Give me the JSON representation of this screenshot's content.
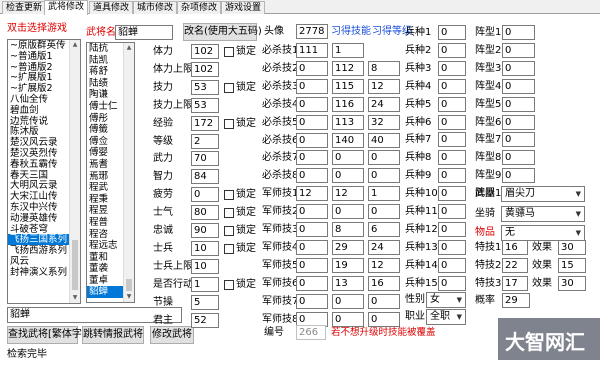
{
  "tabs": [
    {
      "label": "检查更新"
    },
    {
      "label": "武将修改"
    },
    {
      "label": "道具修改"
    },
    {
      "label": "城市修改"
    },
    {
      "label": "杂项修改"
    },
    {
      "label": "游戏设置"
    }
  ],
  "left": {
    "header": "双击选择游戏",
    "games": [
      "~原版群英传",
      "~普通版1",
      "~普通版2",
      "~扩展版1",
      "~扩展版2",
      "八仙全传",
      "碧血剑",
      "边荒传说",
      "陈沐版",
      "楚汉风云录",
      "楚汉英烈传",
      "春秋五霸传",
      "春天三国",
      "大明风云录",
      "大宋江山传",
      "东汉中兴传",
      "动漫英雄传",
      "斗破苍穹",
      "飞扬三国系列",
      "飞扬西游系列",
      "风云",
      "封神演义系列"
    ],
    "selected_game": "飞扬三国系列",
    "search_value": "貂蝉",
    "btn_search": "查找武将[繁体字]",
    "btn_jump": "跳转情报武将",
    "status": "检索完毕"
  },
  "generals": {
    "header": "武将名",
    "name_value": "貂蝉",
    "items": [
      "陆抗",
      "陆凯",
      "蒋舒",
      "陆绩",
      "陶谦",
      "傅士仁",
      "傅彤",
      "傅籤",
      "傅佥",
      "傅婴",
      "焉耆",
      "焉琊",
      "程武",
      "程秉",
      "程昱",
      "程普",
      "程咨",
      "程远志",
      "董和",
      "董袭",
      "董卓",
      "貂蝉"
    ],
    "selected": "貂蝉"
  },
  "edit": {
    "btn_rename": "改名(使用大五码)",
    "btn_modify": "修改武将",
    "lock_label": "锁定"
  },
  "stats": [
    {
      "label": "体力",
      "value": "102",
      "lock": true
    },
    {
      "label": "体力上限",
      "value": "102",
      "lock": false
    },
    {
      "label": "技力",
      "value": "53",
      "lock": true
    },
    {
      "label": "技力上限",
      "value": "53",
      "lock": false
    },
    {
      "label": "经验",
      "value": "172",
      "lock": true
    },
    {
      "label": "等级",
      "value": "2",
      "lock": false
    },
    {
      "label": "武力",
      "value": "70",
      "lock": false
    },
    {
      "label": "智力",
      "value": "84",
      "lock": false
    },
    {
      "label": "疲劳",
      "value": "0",
      "lock": true
    },
    {
      "label": "士气",
      "value": "80",
      "lock": true
    },
    {
      "label": "忠诚",
      "value": "90",
      "lock": true
    },
    {
      "label": "士兵",
      "value": "10",
      "lock": true
    },
    {
      "label": "士兵上限",
      "value": "10",
      "lock": false
    },
    {
      "label": "是否行动",
      "value": "1",
      "lock": true
    },
    {
      "label": "节操",
      "value": "5",
      "lock": false
    },
    {
      "label": "君主",
      "value": "52",
      "lock": false
    }
  ],
  "portrait": {
    "label": "头像",
    "value": "2778",
    "learned_label": "习得技能",
    "level_label": "习得等级"
  },
  "skills": [
    {
      "label": "必杀技1",
      "a": "111",
      "b": "1"
    },
    {
      "label": "必杀技2",
      "a": "0",
      "b": "112",
      "c": "8"
    },
    {
      "label": "必杀技3",
      "a": "0",
      "b": "115",
      "c": "12"
    },
    {
      "label": "必杀技4",
      "a": "0",
      "b": "116",
      "c": "24"
    },
    {
      "label": "必杀技5",
      "a": "0",
      "b": "113",
      "c": "32"
    },
    {
      "label": "必杀技6",
      "a": "0",
      "b": "140",
      "c": "40"
    },
    {
      "label": "必杀技7",
      "a": "0",
      "b": "0",
      "c": "0"
    },
    {
      "label": "必杀技8",
      "a": "0",
      "b": "0",
      "c": "0"
    },
    {
      "label": "军师技1",
      "a": "12",
      "b": "12",
      "c": "1"
    },
    {
      "label": "军师技2",
      "a": "0",
      "b": "0",
      "c": "0"
    },
    {
      "label": "军师技3",
      "a": "0",
      "b": "8",
      "c": "6"
    },
    {
      "label": "军师技4",
      "a": "0",
      "b": "29",
      "c": "24"
    },
    {
      "label": "军师技5",
      "a": "0",
      "b": "19",
      "c": "12"
    },
    {
      "label": "军师技6",
      "a": "0",
      "b": "13",
      "c": "16"
    },
    {
      "label": "军师技7",
      "a": "0",
      "b": "0",
      "c": "0"
    },
    {
      "label": "军师技8",
      "a": "0",
      "b": "0",
      "c": "0"
    }
  ],
  "id": {
    "label": "编号",
    "value": "266"
  },
  "warning": "若不想升级时技能被覆盖",
  "troops": [
    {
      "label": "兵种1",
      "value": "0"
    },
    {
      "label": "兵种2",
      "value": "0"
    },
    {
      "label": "兵种3",
      "value": "0"
    },
    {
      "label": "兵种4",
      "value": "0"
    },
    {
      "label": "兵种5",
      "value": "0"
    },
    {
      "label": "兵种6",
      "value": "0"
    },
    {
      "label": "兵种7",
      "value": "0"
    },
    {
      "label": "兵种8",
      "value": "0"
    },
    {
      "label": "兵种9",
      "value": "0"
    },
    {
      "label": "兵种10",
      "value": "0"
    },
    {
      "label": "兵种11",
      "value": "0"
    },
    {
      "label": "兵种12",
      "value": "0"
    },
    {
      "label": "兵种13",
      "value": "0"
    },
    {
      "label": "兵种14",
      "value": "0"
    },
    {
      "label": "兵种15",
      "value": "0"
    }
  ],
  "gender": {
    "label": "性别",
    "value": "女"
  },
  "job": {
    "label": "职业",
    "value": "全职"
  },
  "formations": [
    {
      "label": "阵型1",
      "value": "0"
    },
    {
      "label": "阵型2",
      "value": "0"
    },
    {
      "label": "阵型3",
      "value": "0"
    },
    {
      "label": "阵型4",
      "value": "0"
    },
    {
      "label": "阵型5",
      "value": "0"
    },
    {
      "label": "阵型6",
      "value": "0"
    },
    {
      "label": "阵型7",
      "value": "0"
    },
    {
      "label": "阵型8",
      "value": "0"
    },
    {
      "label": "阵型9",
      "value": "0"
    },
    {
      "label": "阵型10",
      "value": "0"
    }
  ],
  "equip": [
    {
      "label": "武器",
      "value": "眉尖刀",
      "red": false
    },
    {
      "label": "坐骑",
      "value": "黄骠马",
      "red": false
    },
    {
      "label": "物品",
      "value": "无",
      "red": true
    }
  ],
  "specials": [
    {
      "label": "特技1",
      "value": "16",
      "effect_label": "效果",
      "effect": "30"
    },
    {
      "label": "特技2",
      "value": "22",
      "effect_label": "效果",
      "effect": "15"
    },
    {
      "label": "特技3",
      "value": "17",
      "effect_label": "效果",
      "effect": "30"
    }
  ],
  "rate": {
    "label": "概率",
    "value": "29"
  },
  "watermark": "大智网汇"
}
